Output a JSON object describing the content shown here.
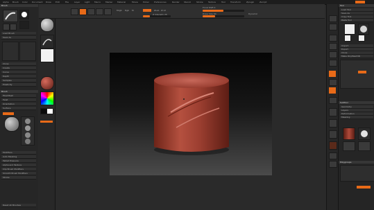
{
  "app": {
    "accent": "#e86a18",
    "canvas_object": "cylinder-mesh"
  },
  "menubar": {
    "items": [
      "Alpha",
      "Brush",
      "Color",
      "Document",
      "Draw",
      "Edit",
      "File",
      "Layer",
      "Light",
      "Macro",
      "Marker",
      "Material",
      "Movie",
      "Picker",
      "Preferences",
      "Render",
      "Stencil",
      "Stroke",
      "Texture",
      "Tool",
      "Transform",
      "Zplugin",
      "Zscript"
    ]
  },
  "shelf": {
    "buttons": [
      "Edit",
      "Draw",
      "Move",
      "Scale",
      "Rotate"
    ],
    "mrgb": "Mrgb",
    "rgb": "Rgb",
    "m": "M",
    "zadd": "Zadd",
    "zsub": "Zsub",
    "zcut": "Zcut",
    "focal_shift": "Focal Shift 0",
    "draw_size": "Draw Size 64",
    "z_intensity": "Z Intensity 25",
    "rgb_intensity": "Rgb Intensity 100",
    "dynamic": "Dynamic"
  },
  "left_panel": {
    "header": "Brush",
    "menu_items": [
      "Load Brush",
      "Save As",
      "Clone",
      "Create",
      "Curve",
      "Depth",
      "Samples",
      "Elasticity",
      "FiberMesh",
      "Twist",
      "Orientation",
      "Surface",
      "Modifiers",
      "Auto Masking",
      "Tablet Pressure",
      "Alpha and Texture",
      "Clip Brush Modifiers",
      "Smooth Brush Modifiers"
    ],
    "brush_section": "Brush",
    "stroke_label": "Stroke",
    "reset": "Reset All Brushes"
  },
  "right_panel": {
    "header": "Tool",
    "menu_items": [
      "Load Tool",
      "Save As",
      "Copy Tool",
      "Paste Tool",
      "Import",
      "Export",
      "Clone",
      "Make PolyMesh3D",
      "GoZ",
      "All",
      "Visible",
      "R"
    ],
    "subtool": "SubTool",
    "geometry": "Geometry",
    "layers": "Layers",
    "deformation": "Deformation",
    "masking": "Masking",
    "polygroups": "Polygroups"
  }
}
